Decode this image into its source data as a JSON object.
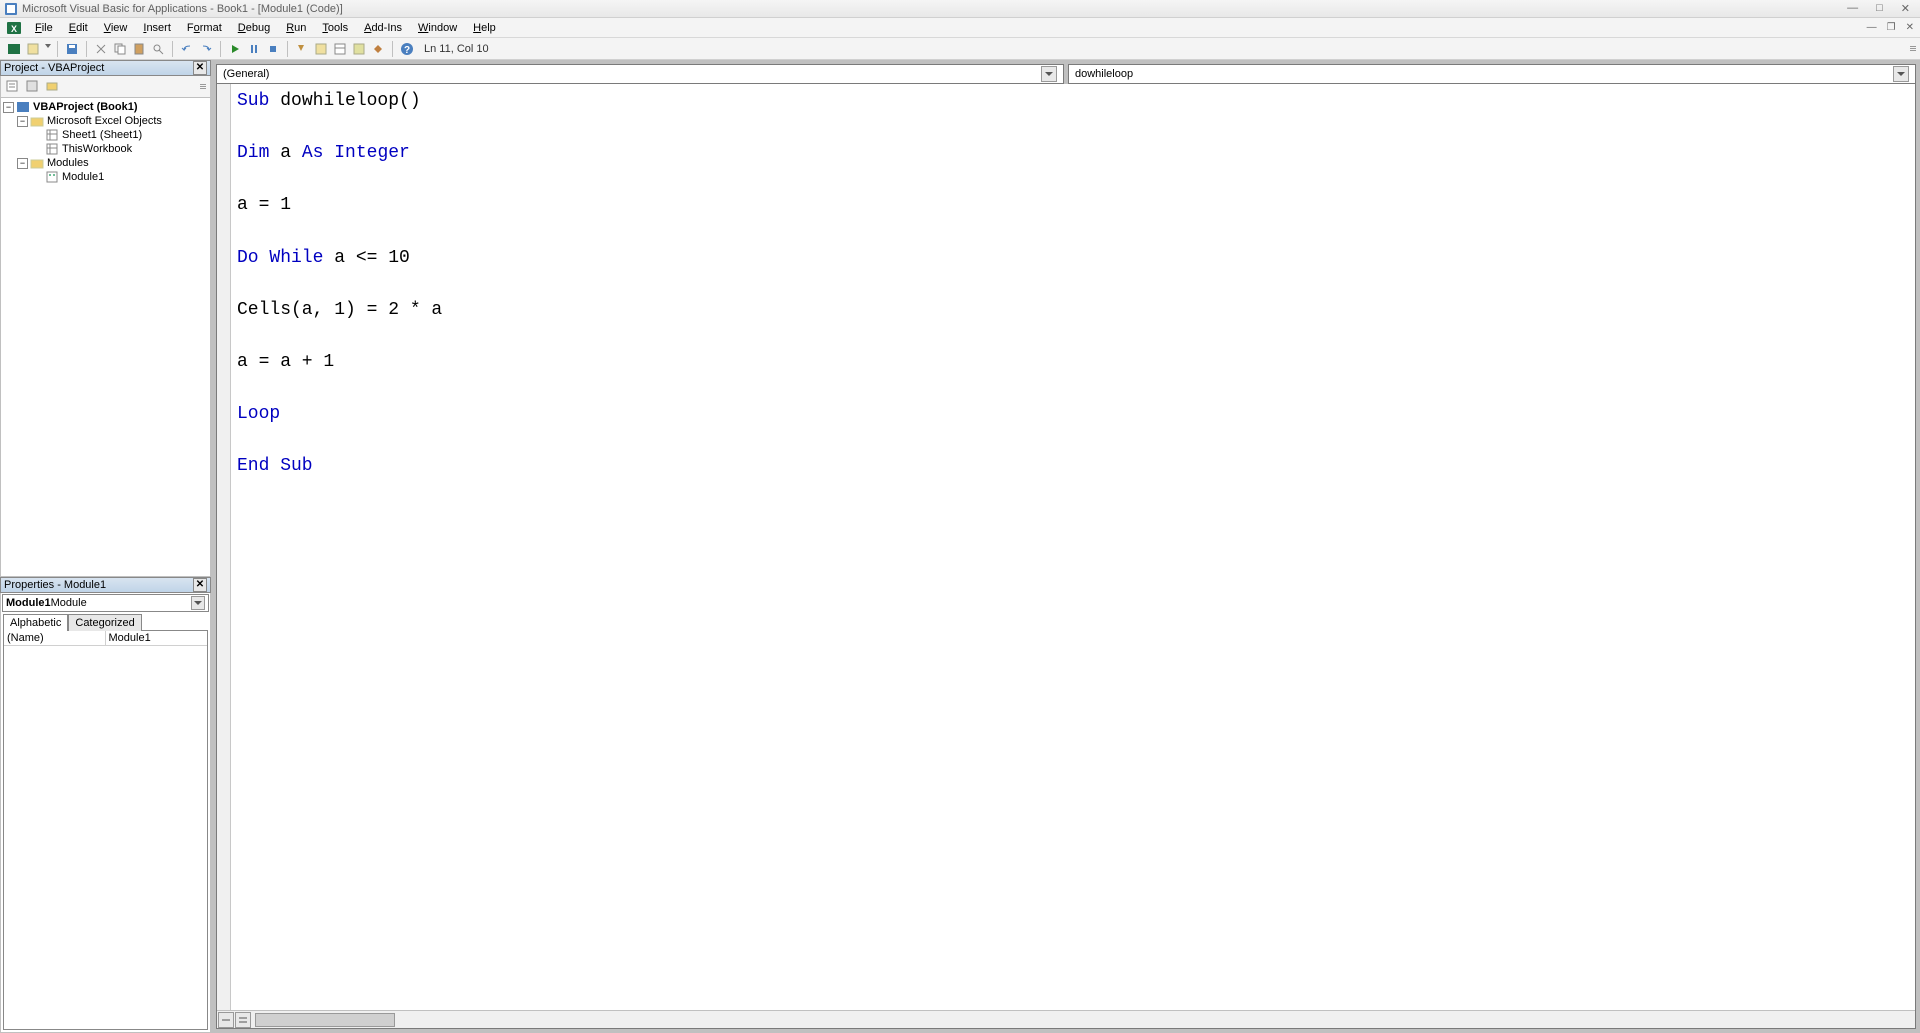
{
  "titlebar": {
    "title": "Microsoft Visual Basic for Applications - Book1 - [Module1 (Code)]"
  },
  "menu": {
    "items": [
      "File",
      "Edit",
      "View",
      "Insert",
      "Format",
      "Debug",
      "Run",
      "Tools",
      "Add-Ins",
      "Window",
      "Help"
    ]
  },
  "toolbar": {
    "cursor_status": "Ln 11, Col 10"
  },
  "project_panel": {
    "title": "Project - VBAProject",
    "tree": {
      "root": "VBAProject (Book1)",
      "excel_objects": "Microsoft Excel Objects",
      "sheet1": "Sheet1 (Sheet1)",
      "thisworkbook": "ThisWorkbook",
      "modules": "Modules",
      "module1": "Module1"
    }
  },
  "properties_panel": {
    "title": "Properties - Module1",
    "combo_bold": "Module1",
    "combo_rest": " Module",
    "tabs": {
      "alphabetic": "Alphabetic",
      "categorized": "Categorized"
    },
    "rows": [
      {
        "name": "(Name)",
        "value": "Module1"
      }
    ]
  },
  "code": {
    "object_dropdown": "(General)",
    "procedure_dropdown": "dowhileloop",
    "lines": [
      {
        "tokens": [
          {
            "t": "Sub ",
            "k": true
          },
          {
            "t": "dowhileloop()",
            "k": false
          }
        ]
      },
      {
        "tokens": []
      },
      {
        "tokens": [
          {
            "t": "Dim ",
            "k": true
          },
          {
            "t": "a ",
            "k": false
          },
          {
            "t": "As Integer",
            "k": true
          }
        ]
      },
      {
        "tokens": []
      },
      {
        "tokens": [
          {
            "t": "a = 1",
            "k": false
          }
        ]
      },
      {
        "tokens": []
      },
      {
        "tokens": [
          {
            "t": "Do While ",
            "k": true
          },
          {
            "t": "a <= 10",
            "k": false
          }
        ]
      },
      {
        "tokens": []
      },
      {
        "tokens": [
          {
            "t": "Cells(a, 1) = 2 * a",
            "k": false
          }
        ]
      },
      {
        "tokens": []
      },
      {
        "tokens": [
          {
            "t": "a = a + 1",
            "k": false
          }
        ]
      },
      {
        "tokens": []
      },
      {
        "tokens": [
          {
            "t": "Loop",
            "k": true
          }
        ]
      },
      {
        "tokens": []
      },
      {
        "tokens": [
          {
            "t": "End Sub",
            "k": true
          }
        ]
      }
    ]
  }
}
